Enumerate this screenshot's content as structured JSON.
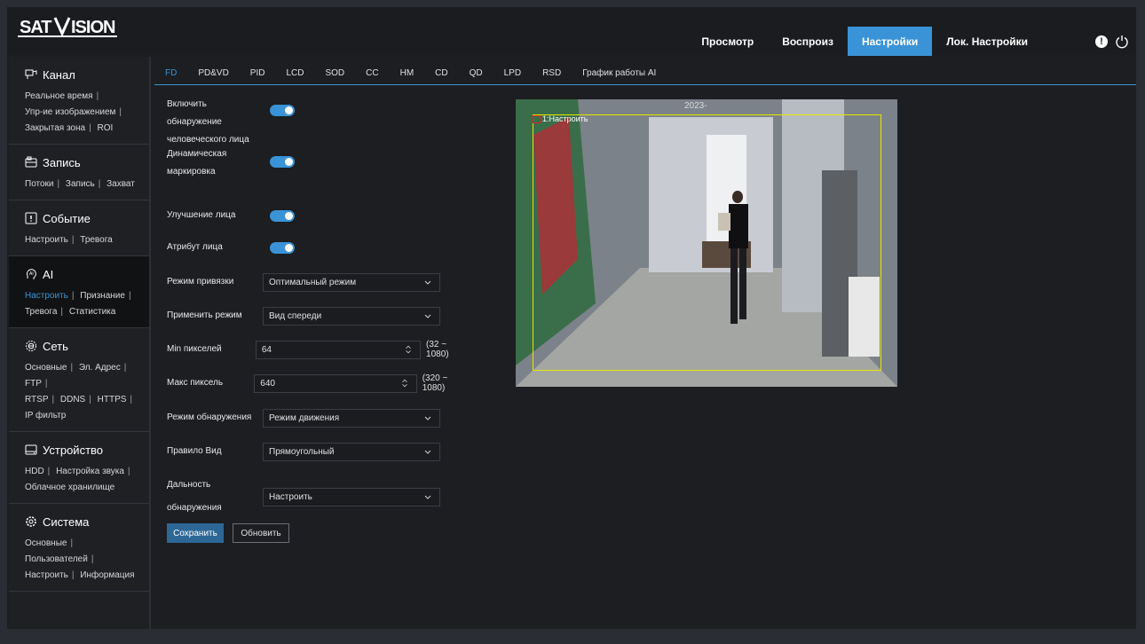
{
  "brand": {
    "logo_text": "SATVISION"
  },
  "nav": {
    "items": [
      "Просмотр",
      "Воспроиз",
      "Настройки",
      "Лок. Настройки"
    ],
    "active_index": 2
  },
  "sidebar": {
    "sections": [
      {
        "title": "Канал",
        "icon": "channel-icon",
        "links": [
          "Реальное время",
          "Упр-ие изображением",
          "Закрытая зона",
          "ROI"
        ]
      },
      {
        "title": "Запись",
        "icon": "record-icon",
        "links": [
          "Потоки",
          "Запись",
          "Захват"
        ]
      },
      {
        "title": "Событие",
        "icon": "event-icon",
        "links": [
          "Настроить",
          "Тревога"
        ]
      },
      {
        "title": "AI",
        "icon": "ai-icon",
        "links": [
          "Настроить",
          "Признание",
          "Тревога",
          "Статистика"
        ]
      },
      {
        "title": "Сеть",
        "icon": "network-icon",
        "links": [
          "Основные",
          "Эл. Адрес",
          "FTP",
          "RTSP",
          "DDNS",
          "HTTPS",
          "IP фильтр"
        ]
      },
      {
        "title": "Устройство",
        "icon": "device-icon",
        "links": [
          "HDD",
          "Настройка звука",
          "Облачное хранилище"
        ]
      },
      {
        "title": "Система",
        "icon": "system-icon",
        "links": [
          "Основные",
          "Пользователей",
          "Настроить",
          "Информация"
        ]
      }
    ]
  },
  "tabs": [
    "FD",
    "PD&VD",
    "PID",
    "LCD",
    "SOD",
    "CC",
    "HM",
    "CD",
    "QD",
    "LPD",
    "RSD",
    "График работы AI"
  ],
  "form": {
    "enable_face_line1": "Включить обнаружение",
    "enable_face_line2": "человеческого лица",
    "dynamic_mark_line1": "Динамическая",
    "dynamic_mark_line2": "маркировка",
    "face_enhance": "Улучшение лица",
    "face_attribute": "Атрибут лица",
    "snap_mode_label": "Режим привязки",
    "snap_mode_value": "Оптимальный режим",
    "apply_mode_label": "Применить режим",
    "apply_mode_value": "Вид спереди",
    "min_pixels_label": "Min пикселей",
    "min_pixels_value": "64",
    "min_pixels_range": "(32 ~ 1080)",
    "max_pixels_label": "Макс пиксель",
    "max_pixels_value": "640",
    "max_pixels_range": "(320 ~ 1080)",
    "detect_mode_label": "Режим обнаружения",
    "detect_mode_value": "Режим движения",
    "rule_view_label": "Правило Вид",
    "rule_view_value": "Прямоугольный",
    "detect_range_label": "Дальность обнаружения",
    "detect_range_value": "Настроить"
  },
  "buttons": {
    "save": "Сохранить",
    "refresh": "Обновить"
  },
  "video": {
    "osd_time": "2023-",
    "region_label": "1:Настроить"
  },
  "colors": {
    "accent": "#3a93d6",
    "detect_box": "#e6e600",
    "region_marker": "#e02020"
  }
}
